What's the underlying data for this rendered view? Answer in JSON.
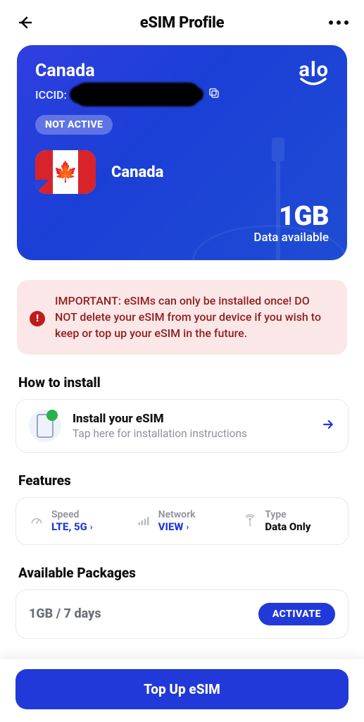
{
  "header": {
    "title": "eSIM Profile"
  },
  "card": {
    "country": "Canada",
    "brand": "alo",
    "iccid_label": "ICCID:",
    "iccid_value": "",
    "status": "NOT ACTIVE",
    "country_name": "Canada",
    "data_amount": "1GB",
    "data_subtitle": "Data available"
  },
  "alert": {
    "text": "IMPORTANT: eSIMs can only be installed once! DO NOT delete your eSIM from your device if you wish to keep or top up your eSIM in the future."
  },
  "install_section": {
    "heading": "How to install",
    "title": "Install your eSIM",
    "subtitle": "Tap here for installation instructions"
  },
  "features": {
    "heading": "Features",
    "speed": {
      "label": "Speed",
      "value": "LTE, 5G"
    },
    "network": {
      "label": "Network",
      "value": "VIEW"
    },
    "type": {
      "label": "Type",
      "value": "Data Only"
    }
  },
  "packages": {
    "heading": "Available Packages",
    "items": [
      {
        "name": "1GB / 7 days",
        "action": "ACTIVATE"
      }
    ]
  },
  "bottom": {
    "topup": "Top Up eSIM"
  }
}
